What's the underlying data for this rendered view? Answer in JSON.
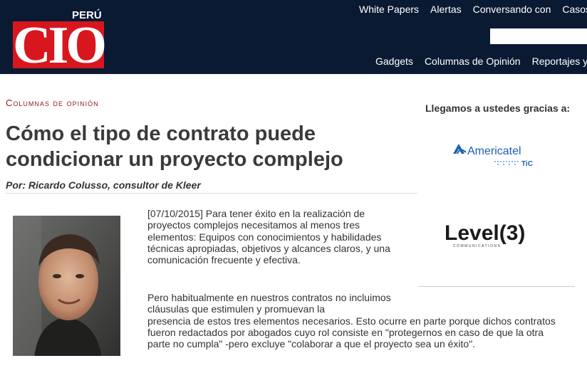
{
  "header": {
    "logo_text": "CIO",
    "logo_country": "PERÚ",
    "top_nav": [
      "White Papers",
      "Alertas",
      "Conversando con",
      "Casos"
    ],
    "sub_nav": [
      "Gadgets",
      "Columnas de Opinión",
      "Reportajes y A"
    ],
    "search": {
      "value": "",
      "placeholder": ""
    }
  },
  "article": {
    "section": "Columnas de opinión",
    "title": "Cómo el tipo de contrato puede condicionar un proyecto complejo",
    "byline": "Por: Ricardo Colusso, consultor de Kleer",
    "paragraph1": "[07/10/2015] Para tener éxito en la realización de proyectos complejos necesitamos al menos tres elementos: Equipos con conocimientos y habilidades técnicas apropiadas, objetivos y alcances claros, y una comunicación frecuente y efectiva.",
    "paragraph2_a": "Pero habitualmente en nuestros contratos no incluimos cláusulas que estimulen y promuevan la",
    "paragraph2_b": "presencia de estos tres elementos necesarios. Esto ocurre en parte porque dichos contratos fueron redactados por abogados cuyo rol consiste en \"protegernos en caso de que la otra parte no cumpla\" -pero excluye \"colaborar a que el proyecto sea un éxito\"."
  },
  "sidebar": {
    "sponsor_title": "Llegamos a ustedes gracias a:",
    "sponsor1_name": "Americatel",
    "sponsor1_sub": "TiC",
    "sponsor2_name": "Level(3)",
    "sponsor2_sub": "COMMUNICATIONS"
  },
  "colors": {
    "header_bg": "#0b1a33",
    "logo_red": "#d8161e",
    "section_red": "#8a1a1a"
  }
}
